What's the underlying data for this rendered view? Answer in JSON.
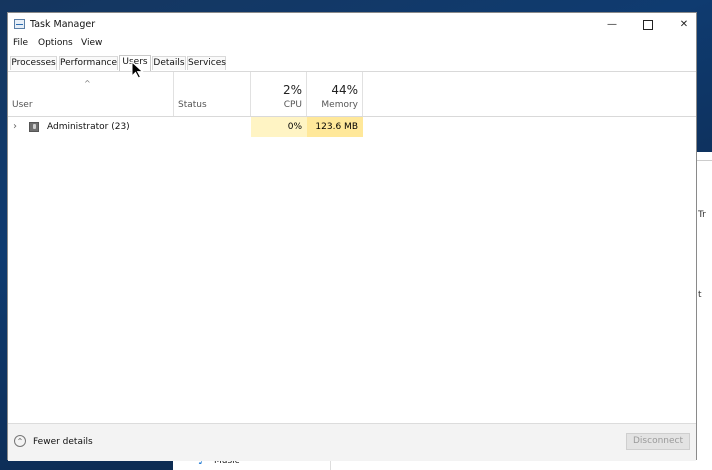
{
  "window": {
    "title": "Task Manager",
    "controls": {
      "minimize": "—",
      "close": "✕"
    }
  },
  "menu": [
    "File",
    "Options",
    "View"
  ],
  "tabs": [
    {
      "label": "Processes",
      "active": false
    },
    {
      "label": "Performance",
      "active": false
    },
    {
      "label": "Users",
      "active": true
    },
    {
      "label": "Details",
      "active": false
    },
    {
      "label": "Services",
      "active": false
    }
  ],
  "columns": {
    "sort_indicator": "^",
    "user": "User",
    "status": "Status",
    "cpu": {
      "label": "CPU",
      "total": "2%"
    },
    "memory": {
      "label": "Memory",
      "total": "44%"
    }
  },
  "rows": [
    {
      "expand_icon": "›",
      "name": "Administrator (23)",
      "status": "",
      "cpu": "0%",
      "memory": "123.6 MB"
    }
  ],
  "footer": {
    "fewer_details_label": "Fewer details",
    "fewer_details_icon": "⌃",
    "disconnect_label": "Disconnect"
  },
  "background_window": {
    "music_label": "Music",
    "edge_text_1": "Tr",
    "edge_text_2": "t"
  },
  "colors": {
    "cpu_heat": "#fff4c4",
    "memory_heat": "#ffe89a"
  }
}
